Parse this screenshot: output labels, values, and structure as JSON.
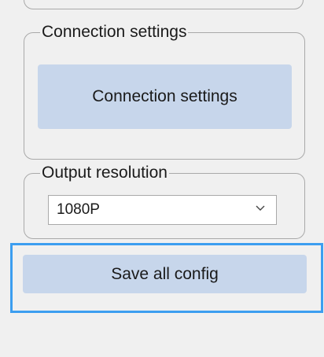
{
  "connection_group": {
    "legend": "Connection settings",
    "button_label": "Connection settings"
  },
  "resolution_group": {
    "legend": "Output resolution",
    "selected": "1080P"
  },
  "save_button": {
    "label": "Save all config"
  },
  "colors": {
    "background": "#f0f0f0",
    "button_fill": "#c7d6eb",
    "focus_border": "#3c9ef0",
    "group_border": "#a9a9a9"
  },
  "icons": [
    "chevron-down-icon"
  ]
}
